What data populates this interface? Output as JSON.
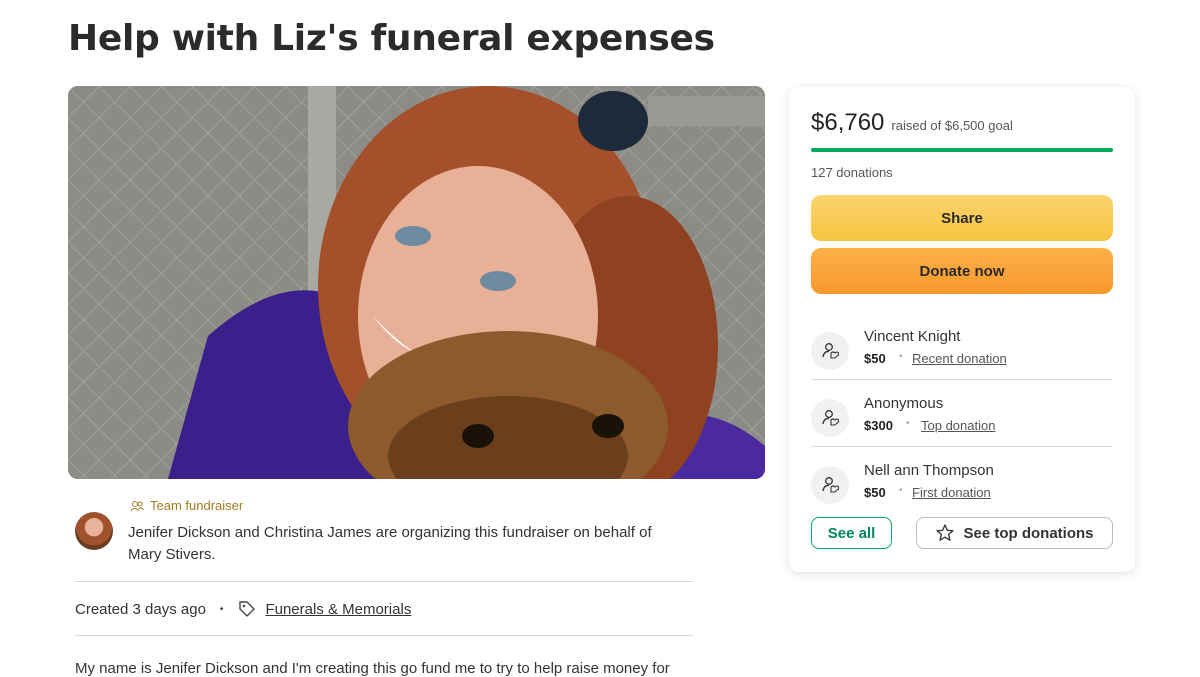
{
  "page": {
    "title": "Help with Liz's funeral expenses"
  },
  "organizer": {
    "badge": "Team fundraiser",
    "text": "Jenifer Dickson and Christina James are organizing this fundraiser on behalf of Mary Stivers."
  },
  "meta": {
    "created": "Created 3 days ago",
    "dot": "•",
    "category": "Funerals & Memorials"
  },
  "story": {
    "first_line": "My name is Jenifer Dickson and I'm creating this go fund me to try to help raise money for"
  },
  "donation_card": {
    "raised": "$6,760",
    "goal": "raised of $6,500 goal",
    "progress_fraction": 1.0,
    "donations_count": "127 donations",
    "share_label": "Share",
    "donate_label": "Donate now",
    "donors": [
      {
        "name": "Vincent Knight",
        "amount": "$50",
        "type": "Recent donation"
      },
      {
        "name": "Anonymous",
        "amount": "$300",
        "type": "Top donation"
      },
      {
        "name": "Nell ann Thompson",
        "amount": "$50",
        "type": "First donation"
      }
    ],
    "separator": "•",
    "see_all_label": "See all",
    "see_top_label": "See top donations"
  },
  "colors": {
    "brand_green": "#02a95c",
    "share_yellow": "#f6c440",
    "donate_orange": "#f7982b"
  }
}
